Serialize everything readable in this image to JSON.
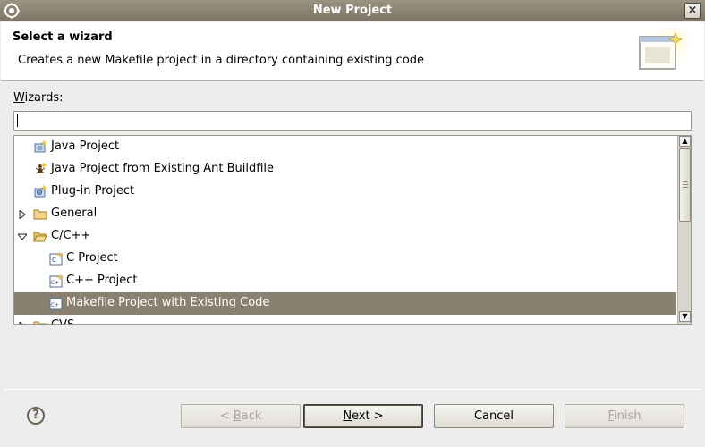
{
  "window": {
    "title": "New Project",
    "close_glyph": "×"
  },
  "banner": {
    "heading": "Select a wizard",
    "description": "Creates a new Makefile project in a directory containing existing code"
  },
  "wizards": {
    "label_mnemonic": "W",
    "label_rest": "izards:",
    "filter_value": ""
  },
  "tree": {
    "items": [
      {
        "label": "Java Project",
        "icon": "java-project-icon",
        "twisty": "none",
        "level": 1
      },
      {
        "label": "Java Project from Existing Ant Buildfile",
        "icon": "ant-icon",
        "twisty": "none",
        "level": 1
      },
      {
        "label": "Plug-in Project",
        "icon": "plugin-project-icon",
        "twisty": "none",
        "level": 1
      },
      {
        "label": "General",
        "icon": "folder-icon",
        "twisty": "collapsed",
        "level": 0
      },
      {
        "label": "C/C++",
        "icon": "folder-open-icon",
        "twisty": "expanded",
        "level": 0
      },
      {
        "label": "C Project",
        "icon": "c-project-icon",
        "twisty": "none",
        "level": 2
      },
      {
        "label": "C++ Project",
        "icon": "cpp-project-icon",
        "twisty": "none",
        "level": 2
      },
      {
        "label": "Makefile Project with Existing Code",
        "icon": "makefile-project-icon",
        "twisty": "none",
        "level": 2,
        "selected": true
      },
      {
        "label": "CVS",
        "icon": "folder-icon",
        "twisty": "collapsed",
        "level": 0
      }
    ]
  },
  "buttons": {
    "back_pre": "< ",
    "back_mn": "B",
    "back_post": "ack",
    "next_mn": "N",
    "next_post": "ext >",
    "cancel": "Cancel",
    "finish_mn": "F",
    "finish_post": "inish",
    "help": "?"
  },
  "colors": {
    "selection": "#8a8070",
    "titlebar": "#8a8070"
  }
}
